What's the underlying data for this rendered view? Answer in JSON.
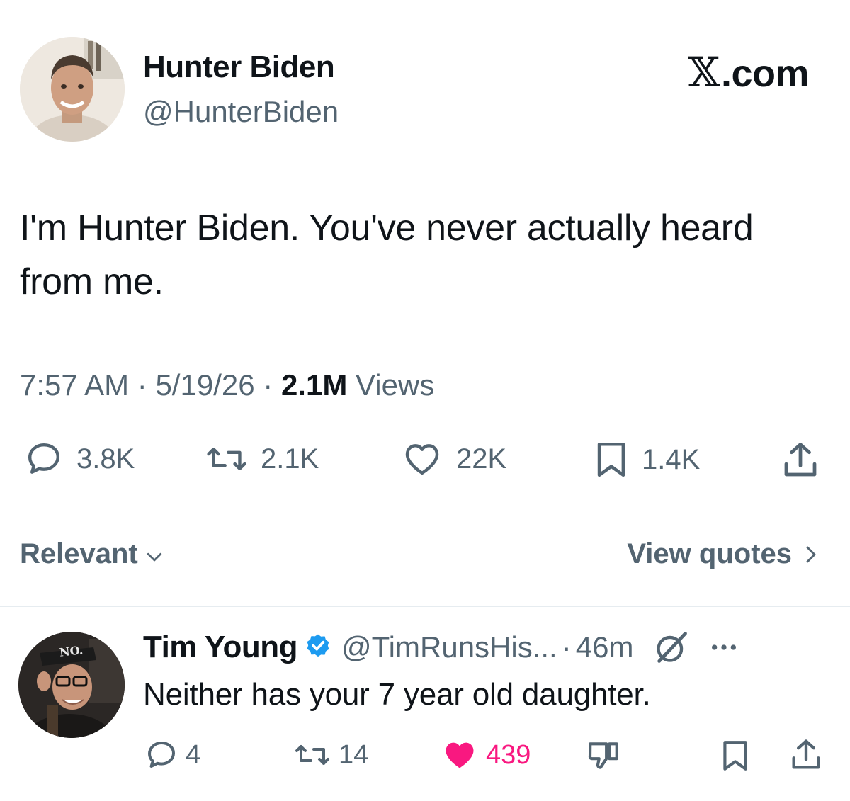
{
  "tweet": {
    "author_name": "Hunter Biden",
    "author_handle": "@HunterBiden",
    "brand": ".com",
    "text": "I'm Hunter Biden. You've never actually heard from me.",
    "time": "7:57 AM",
    "sep": "·",
    "date": "5/19/26",
    "views_count": "2.1M",
    "views_label": "Views",
    "actions": {
      "replies": "3.8K",
      "reposts": "2.1K",
      "likes": "22K",
      "bookmarks": "1.4K"
    }
  },
  "sort": {
    "label": "Relevant"
  },
  "view_quotes": {
    "label": "View quotes"
  },
  "reply": {
    "author_name": "Tim Young",
    "author_handle": "@TimRunsHis...",
    "sep": "·",
    "time": "46m",
    "text": "Neither has your 7 year old daughter.",
    "avatar_cap_text": "NO.",
    "actions": {
      "replies": "4",
      "reposts": "14",
      "likes": "439"
    }
  },
  "colors": {
    "text": "#0f1419",
    "secondary": "#536471",
    "like_active": "#f91880",
    "verified": "#1d9bf0"
  }
}
